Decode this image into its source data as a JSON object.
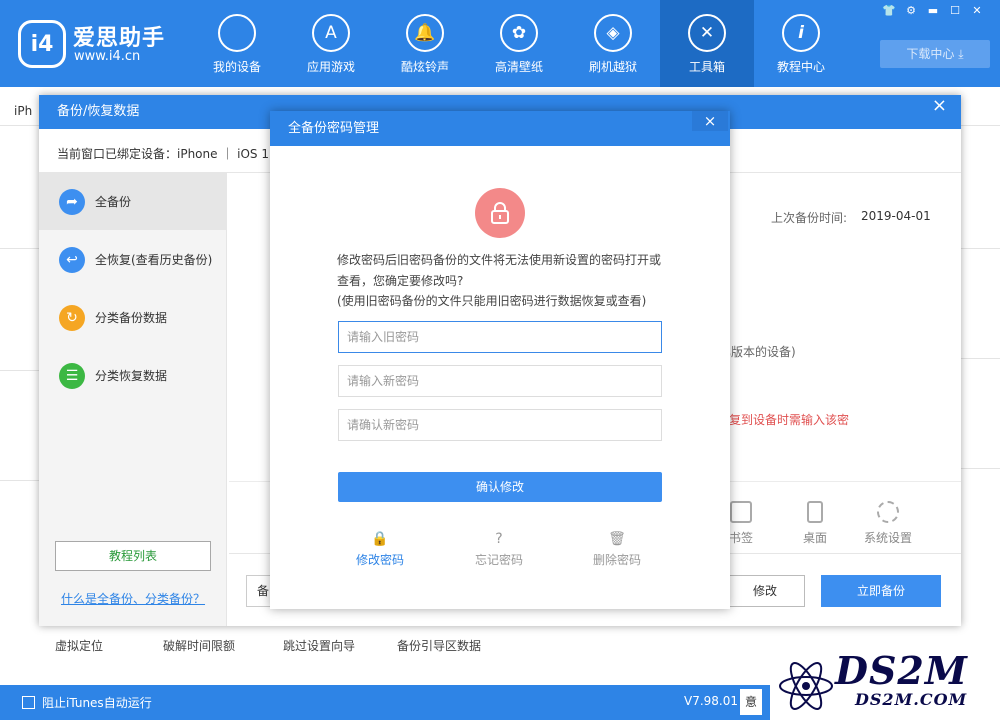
{
  "app": {
    "logo_mark": "i4",
    "name": "爱思助手",
    "url": "www.i4.cn",
    "download_center": "下载中心"
  },
  "nav": [
    {
      "label": "我的设备",
      "icon": "apple-icon"
    },
    {
      "label": "应用游戏",
      "icon": "app-store-icon"
    },
    {
      "label": "酷炫铃声",
      "icon": "bell-icon"
    },
    {
      "label": "高清壁纸",
      "icon": "flower-icon"
    },
    {
      "label": "刷机越狱",
      "icon": "dropbox-icon"
    },
    {
      "label": "工具箱",
      "icon": "tools-icon",
      "active": true
    },
    {
      "label": "教程中心",
      "icon": "info-icon"
    }
  ],
  "background": {
    "tab_label": "iPh",
    "tools": [
      "虚拟定位",
      "破解时间限额",
      "跳过设置向导",
      "备份引导区数据"
    ]
  },
  "bottom": {
    "itunes_label": "阻止iTunes自动运行",
    "version": "V7.98.01",
    "version_btn": "意"
  },
  "watermark": {
    "big": "DS2M",
    "small": "DS2M.COM"
  },
  "backup_window": {
    "title": "备份/恢复数据",
    "close": "×",
    "info": "当前窗口已绑定设备：iPhone  ｜ iOS 1",
    "sidebar": [
      {
        "label": "全备份",
        "icon": "share-arrow-icon",
        "color": "#3d8ff0"
      },
      {
        "label": "全恢复(查看历史备份)",
        "icon": "return-arrow-icon",
        "color": "#3d8ff0"
      },
      {
        "label": "分类备份数据",
        "icon": "sync-icon",
        "color": "#f5a623"
      },
      {
        "label": "分类恢复数据",
        "icon": "list-icon",
        "color": "#3cb843"
      }
    ],
    "tutorial_btn": "教程列表",
    "tutorial_link": "什么是全备份、分类备份？",
    "last_backup_label": "上次备份时间:",
    "last_backup_value": "2019-04-01",
    "fragment1": "比版本的设备)",
    "fragment2": "复到设备时需输入该密",
    "options": [
      {
        "label": "书签",
        "icon": "bookmark-icon"
      },
      {
        "label": "桌面",
        "icon": "phone-icon"
      },
      {
        "label": "系统设置",
        "icon": "gear-icon"
      }
    ],
    "input_prefix": "备",
    "modify_btn": "修改",
    "backup_now_btn": "立即备份"
  },
  "dialog": {
    "title": "全备份密码管理",
    "close": "×",
    "warning_line1": "修改密码后旧密码备份的文件将无法使用新设置的密码打开或",
    "warning_line2": "查看，您确定要修改吗?",
    "warning_line3": "(使用旧密码备份的文件只能用旧密码进行数据恢复或查看)",
    "old_placeholder": "请输入旧密码",
    "new_placeholder": "请输入新密码",
    "confirm_placeholder": "请确认新密码",
    "confirm_btn": "确认修改",
    "tabs": [
      {
        "label": "修改密码",
        "icon": "lock-icon",
        "glyph": "🔒",
        "active": true
      },
      {
        "label": "忘记密码",
        "icon": "question-icon",
        "glyph": "?",
        "active": false
      },
      {
        "label": "删除密码",
        "icon": "trash-icon",
        "glyph": "🗑",
        "active": false
      }
    ]
  },
  "window_controls": [
    "shirt-icon",
    "gear-icon",
    "minimize-icon",
    "maximize-icon",
    "close-icon"
  ]
}
